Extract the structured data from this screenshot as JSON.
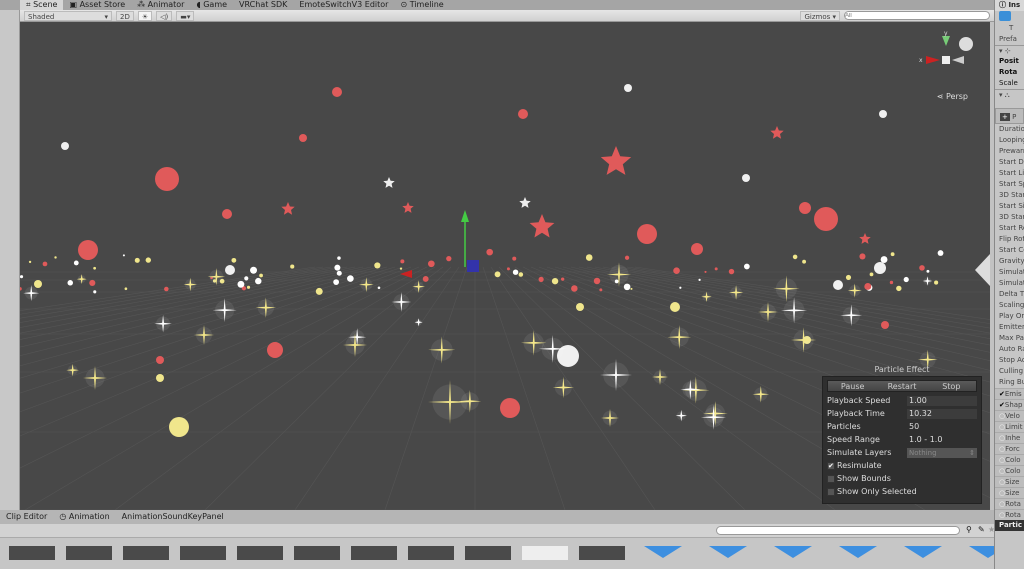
{
  "tabs": [
    {
      "label": "Scene",
      "icon": "hash-icon"
    },
    {
      "label": "Asset Store",
      "icon": "store-icon"
    },
    {
      "label": "Animator",
      "icon": "animator-icon"
    },
    {
      "label": "Game",
      "icon": "pacman-icon"
    },
    {
      "label": "VRChat SDK"
    },
    {
      "label": "EmoteSwitchV3 Editor"
    },
    {
      "label": "Timeline",
      "icon": "timeline-icon"
    }
  ],
  "toolbar": {
    "shading": "Shaded",
    "mode_2d": "2D",
    "gizmos": "Gizmos",
    "search_placeholder": "All"
  },
  "scene": {
    "projection": "Persp",
    "gizmo_labels": {
      "x": "x",
      "y": "y"
    }
  },
  "particle_effect": {
    "title": "Particle Effect",
    "buttons": [
      "Pause",
      "Restart",
      "Stop"
    ],
    "rows": [
      {
        "label": "Playback Speed",
        "value": "1.00"
      },
      {
        "label": "Playback Time",
        "value": "10.32"
      },
      {
        "label": "Particles",
        "value": "50"
      },
      {
        "label": "Speed Range",
        "value": "1.0 - 1.0"
      },
      {
        "label": "Simulate Layers",
        "value": "Nothing"
      }
    ],
    "checks": [
      {
        "label": "Resimulate",
        "checked": true
      },
      {
        "label": "Show Bounds",
        "checked": false
      },
      {
        "label": "Show Only Selected",
        "checked": false
      }
    ]
  },
  "inspector": {
    "tab": "Ins",
    "header": [
      "T",
      "Prefa"
    ],
    "transform": [
      "Posit",
      "Rota",
      "Scale"
    ],
    "module_title": "P",
    "props": [
      "Duratio",
      "Looping",
      "Prewarm",
      "Start De",
      "Start Li",
      "Start Sp",
      "3D Star",
      "Start Si",
      "3D Star",
      "Start Ro",
      "Flip Rot",
      "Start Co",
      "Gravity",
      "Simulat",
      "Simulat",
      "Delta T",
      "Scaling",
      "Play Or",
      "Emitter",
      "Max Pa",
      "Auto Ra",
      "Stop Ac",
      "Culling",
      "Ring Bu"
    ],
    "modules": [
      {
        "label": "Emis",
        "checked": true
      },
      {
        "label": "Shap",
        "checked": true
      },
      {
        "label": "Velo",
        "checked": false
      },
      {
        "label": "Limit",
        "checked": false
      },
      {
        "label": "Inhe",
        "checked": false
      },
      {
        "label": "Forc",
        "checked": false
      },
      {
        "label": "Colo",
        "checked": false
      },
      {
        "label": "Colo",
        "checked": false
      },
      {
        "label": "Size",
        "checked": false
      },
      {
        "label": "Size",
        "checked": false
      },
      {
        "label": "Rota",
        "checked": false
      },
      {
        "label": "Rota",
        "checked": false
      }
    ],
    "footer": "Partic"
  },
  "bottom": {
    "tabs": [
      "Clip Editor",
      "Animation",
      "AnimationSoundKeyPanel"
    ]
  },
  "colors": {
    "scene_bg": "#484848",
    "red_particle": "#e05a5a",
    "white_particle": "#f0f0f0",
    "yellow_particle": "#f0e68c",
    "asset_blue": "#3d8fe0"
  }
}
